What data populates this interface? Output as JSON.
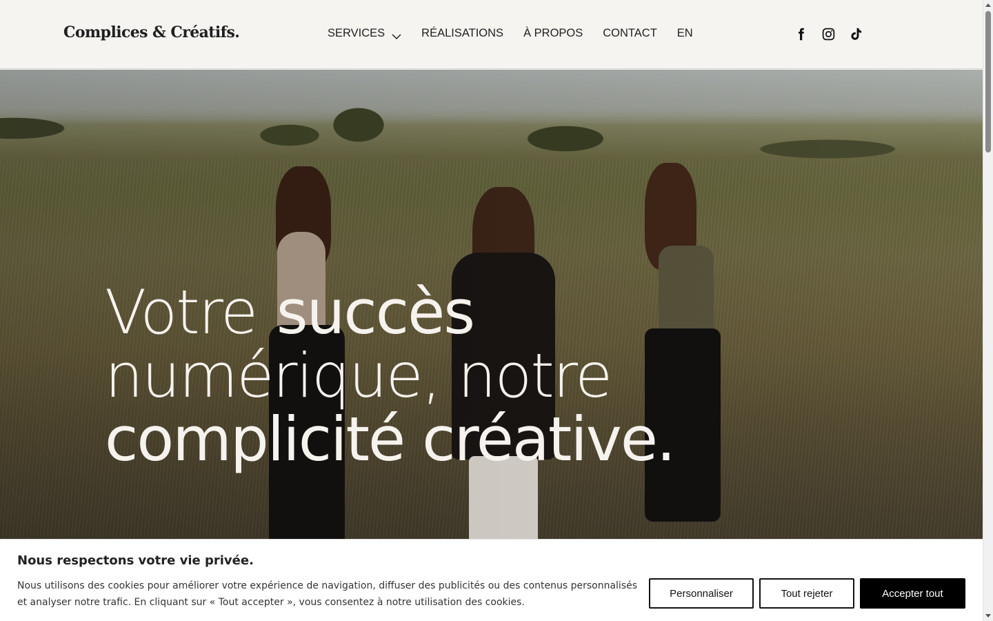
{
  "header": {
    "logo": "Complices & Créatifs.",
    "nav": [
      {
        "label": "SERVICES",
        "has_dropdown": true
      },
      {
        "label": "RÉALISATIONS"
      },
      {
        "label": "À PROPOS"
      },
      {
        "label": "CONTACT"
      },
      {
        "label": "EN"
      }
    ],
    "socials": [
      "facebook-icon",
      "instagram-icon",
      "tiktok-icon"
    ]
  },
  "hero": {
    "headline": {
      "line1_light": "Votre",
      "line1_bold": "succès",
      "line2": "numérique, notre",
      "line3": "complicité créative."
    }
  },
  "cookie_banner": {
    "title": "Nous respectons votre vie privée.",
    "text": "Nous utilisons des cookies pour améliorer votre expérience de navigation, diffuser des publicités ou des contenus personnalisés et analyser notre trafic. En cliquant sur « Tout accepter », vous consentez à notre utilisation des cookies.",
    "buttons": {
      "customize": "Personnaliser",
      "reject": "Tout rejeter",
      "accept": "Accepter tout"
    }
  },
  "colors": {
    "header_bg": "#f5f4f1",
    "text_dark": "#1f1f1f",
    "headline": "#f6f3ee",
    "button_solid": "#000000"
  }
}
